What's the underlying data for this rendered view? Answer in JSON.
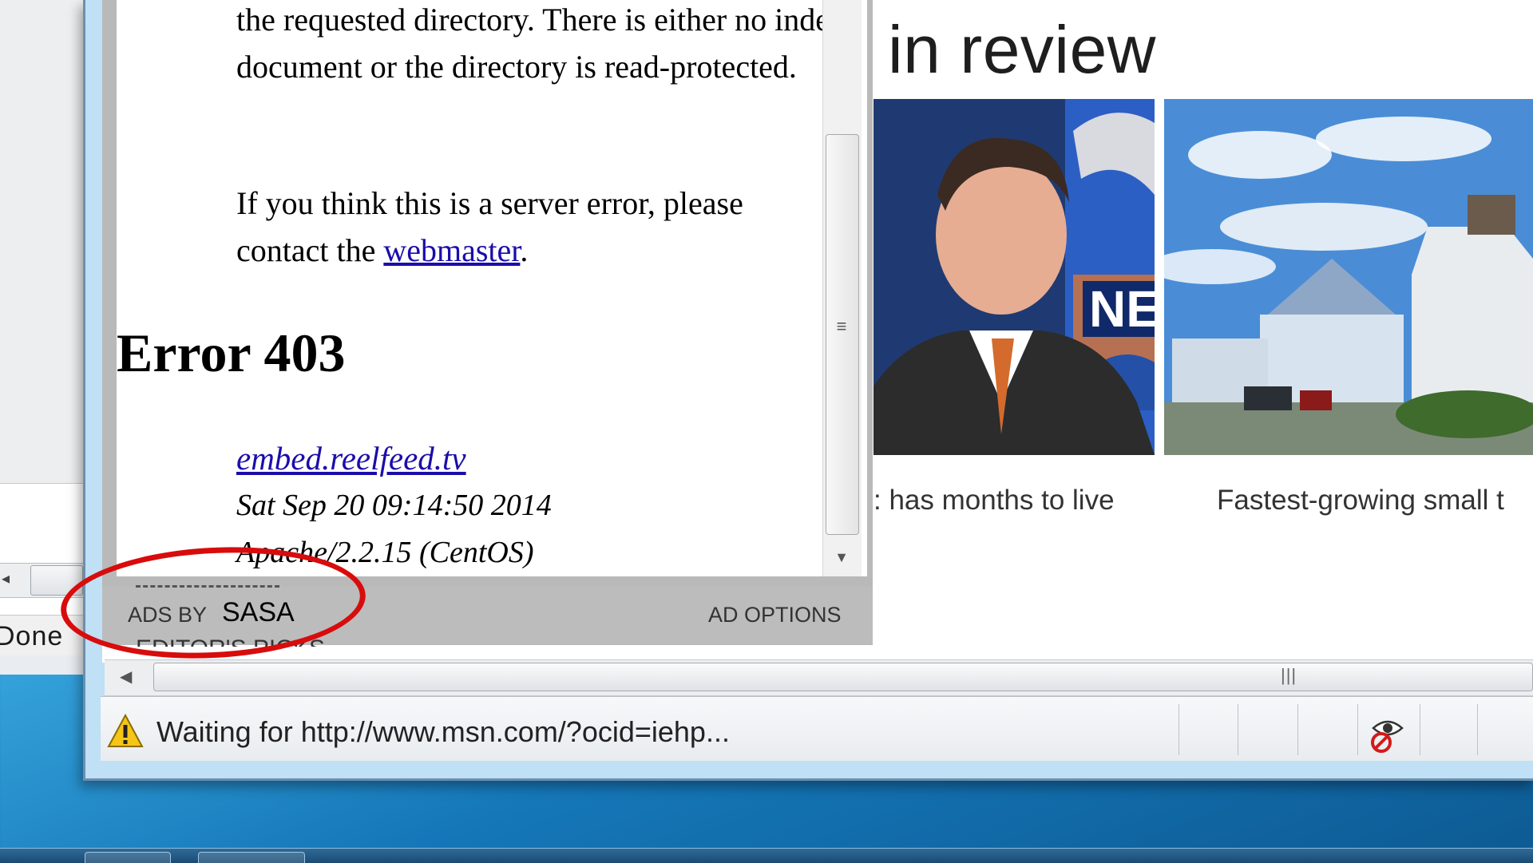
{
  "error_page": {
    "paragraph_1": "the requested directory. There is either no index document or the directory is read-protected.",
    "paragraph_2_prefix": "If you think this is a server error, please contact the",
    "webmaster_link": "webmaster",
    "paragraph_2_suffix": ".",
    "title": "Error 403",
    "host_link": "embed.reelfeed.tv",
    "date": "Sat Sep 20 09:14:50 2014",
    "server": "Apache/2.2.15 (CentOS)"
  },
  "ad_bar": {
    "ads_by_label": "ADS BY",
    "ads_by_name": "SASA",
    "ad_options_label": "AD OPTIONS",
    "peek_text": "EDITOR'S PICKS"
  },
  "msn": {
    "section_heading": "in review",
    "captions": [
      ": has months to live",
      "Fastest-growing small t"
    ]
  },
  "background_window": {
    "status_text": "Done"
  },
  "status_bar": {
    "text": "Waiting for http://www.msn.com/?ocid=iehp...",
    "warning_icon": "warning-icon",
    "privacy_icon": "privacy-blocked-icon"
  },
  "colors": {
    "annotation": "#d80c0c",
    "link": "#1a0dab"
  }
}
